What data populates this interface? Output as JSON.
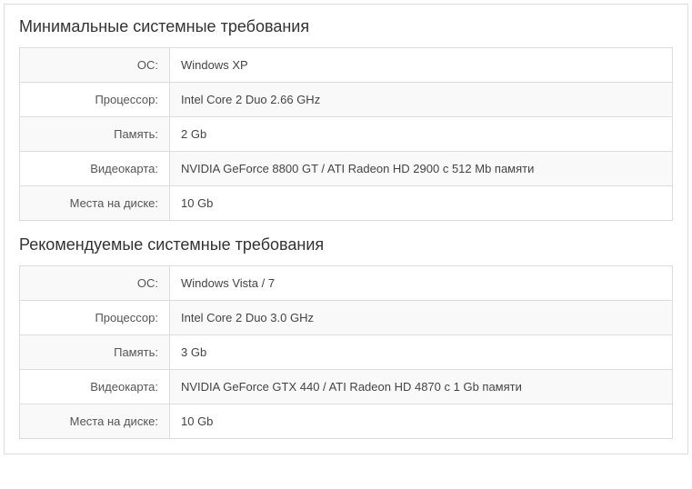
{
  "minimum": {
    "title": "Минимальные системные требования",
    "rows": [
      {
        "label": "ОС:",
        "value": "Windows XP"
      },
      {
        "label": "Процессор:",
        "value": "Intel Core 2 Duo 2.66 GHz"
      },
      {
        "label": "Память:",
        "value": "2 Gb"
      },
      {
        "label": "Видеокарта:",
        "value": "NVIDIA GeForce 8800 GT / ATI Radeon HD 2900 с 512 Mb памяти"
      },
      {
        "label": "Места на диске:",
        "value": "10 Gb"
      }
    ]
  },
  "recommended": {
    "title": "Рекомендуемые системные требования",
    "rows": [
      {
        "label": "ОС:",
        "value": "Windows Vista / 7"
      },
      {
        "label": "Процессор:",
        "value": "Intel Core 2 Duo 3.0 GHz"
      },
      {
        "label": "Память:",
        "value": "3 Gb"
      },
      {
        "label": "Видеокарта:",
        "value": "NVIDIA GeForce GTX 440 / ATI Radeon HD 4870 с 1 Gb памяти"
      },
      {
        "label": "Места на диске:",
        "value": "10 Gb"
      }
    ]
  }
}
